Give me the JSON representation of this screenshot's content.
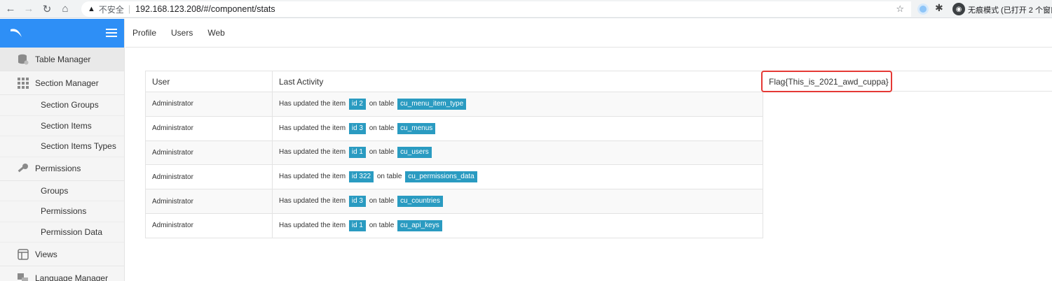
{
  "browser": {
    "insecure_label": "不安全",
    "url": "192.168.123.208/#/component/stats",
    "incognito_label": "无痕模式 (已打开 2 个窗口)"
  },
  "sidebar": {
    "items": [
      {
        "label": "Table Manager",
        "icon": "database-gear-icon",
        "type": "item"
      },
      {
        "label": "Section Manager",
        "icon": "grid-icon",
        "type": "item"
      },
      {
        "label": "Section Groups",
        "type": "sub"
      },
      {
        "label": "Section Items",
        "type": "sub"
      },
      {
        "label": "Section Items Types",
        "type": "sub"
      },
      {
        "label": "Permissions",
        "icon": "key-icon",
        "type": "item"
      },
      {
        "label": "Groups",
        "type": "sub"
      },
      {
        "label": "Permissions",
        "type": "sub"
      },
      {
        "label": "Permission Data",
        "type": "sub"
      },
      {
        "label": "Views",
        "icon": "window-icon",
        "type": "item"
      },
      {
        "label": "Language Manager",
        "icon": "language-icon",
        "type": "item"
      }
    ]
  },
  "topnav": {
    "links": [
      "Profile",
      "Users",
      "Web"
    ]
  },
  "table": {
    "headers": [
      "User",
      "Last Activity"
    ],
    "rows": [
      {
        "user": "Administrator",
        "prefix": "Has updated the item",
        "id": "id 2",
        "middle": "on table",
        "table": "cu_menu_item_type"
      },
      {
        "user": "Administrator",
        "prefix": "Has updated the item",
        "id": "id 3",
        "middle": "on table",
        "table": "cu_menus"
      },
      {
        "user": "Administrator",
        "prefix": "Has updated the item",
        "id": "id 1",
        "middle": "on table",
        "table": "cu_users"
      },
      {
        "user": "Administrator",
        "prefix": "Has updated the item",
        "id": "id 322",
        "middle": "on table",
        "table": "cu_permissions_data"
      },
      {
        "user": "Administrator",
        "prefix": "Has updated the item",
        "id": "id 3",
        "middle": "on table",
        "table": "cu_countries"
      },
      {
        "user": "Administrator",
        "prefix": "Has updated the item",
        "id": "id 1",
        "middle": "on table",
        "table": "cu_api_keys"
      }
    ]
  },
  "flag": {
    "text": "Flag{This_is_2021_awd_cuppa}",
    "highlight_color": "#e53935"
  },
  "colors": {
    "brand": "#2e8ff6",
    "badge": "#2a9bc1"
  }
}
